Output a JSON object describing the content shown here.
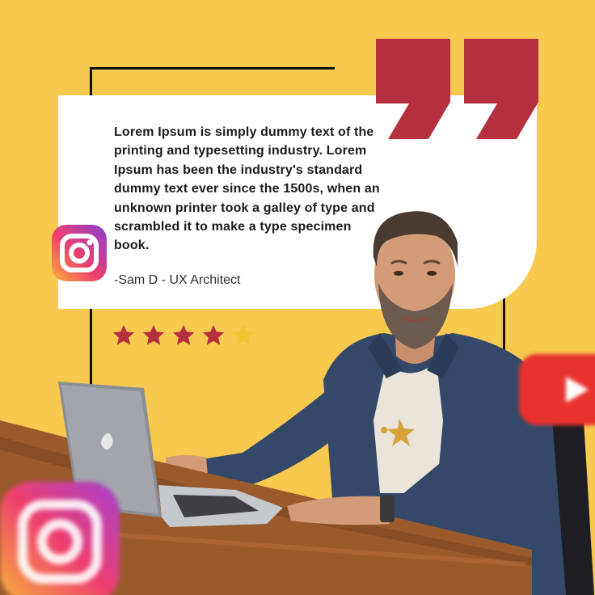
{
  "testimonial": {
    "quote": "Lorem Ipsum is simply dummy text of the printing and typesetting industry. Lorem Ipsum has been the industry's standard dummy text ever since the 1500s, when an unknown printer took a galley of type and scrambled it to make a type specimen book.",
    "author": "-Sam D - UX Architect",
    "rating": 4,
    "rating_max": 5
  },
  "icons": [
    "instagram-icon",
    "youtube-icon",
    "quote-mark-icon",
    "star-icon"
  ],
  "colors": {
    "background": "#f8c94f",
    "accent": "#b5303e",
    "star_filled": "#b5303e",
    "star_empty": "#f2c12e",
    "card": "#ffffff"
  }
}
